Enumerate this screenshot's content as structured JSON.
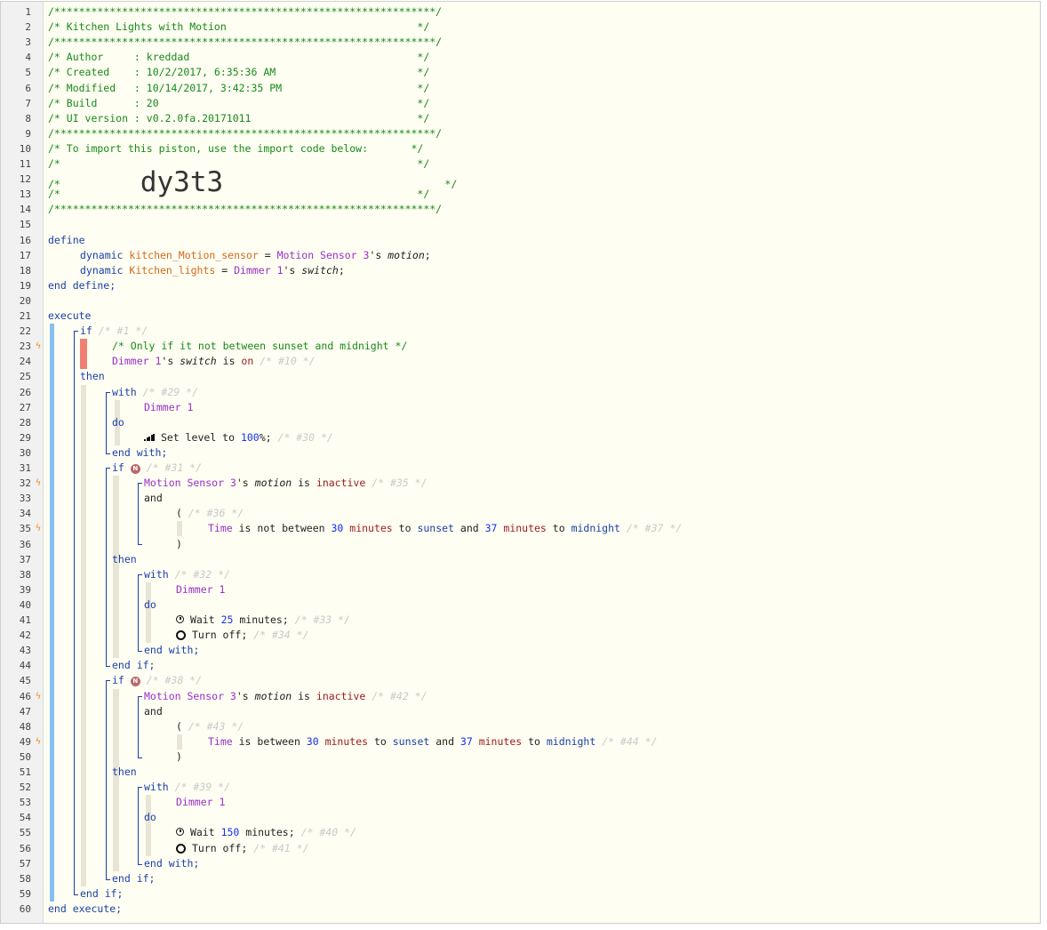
{
  "editor": {
    "lines": [
      {
        "n": 1,
        "indent": 0,
        "segs": [
          [
            "c-comment",
            "/**************************************************************/"
          ]
        ]
      },
      {
        "n": 2,
        "indent": 0,
        "segs": [
          [
            "c-comment",
            "/* Kitchen Lights with Motion                               */"
          ]
        ]
      },
      {
        "n": 3,
        "indent": 0,
        "segs": [
          [
            "c-comment",
            "/**************************************************************/"
          ]
        ]
      },
      {
        "n": 4,
        "indent": 0,
        "segs": [
          [
            "c-comment",
            "/* Author     : kreddad                                     */"
          ]
        ]
      },
      {
        "n": 5,
        "indent": 0,
        "segs": [
          [
            "c-comment",
            "/* Created    : 10/2/2017, 6:35:36 AM                       */"
          ]
        ]
      },
      {
        "n": 6,
        "indent": 0,
        "segs": [
          [
            "c-comment",
            "/* Modified   : 10/14/2017, 3:42:35 PM                      */"
          ]
        ]
      },
      {
        "n": 7,
        "indent": 0,
        "segs": [
          [
            "c-comment",
            "/* Build      : 20                                          */"
          ]
        ]
      },
      {
        "n": 8,
        "indent": 0,
        "segs": [
          [
            "c-comment",
            "/* UI version : v0.2.0fa.20171011                           */"
          ]
        ]
      },
      {
        "n": 9,
        "indent": 0,
        "segs": [
          [
            "c-comment",
            "/**************************************************************/"
          ]
        ]
      },
      {
        "n": 10,
        "indent": 0,
        "segs": [
          [
            "c-comment",
            "/* To import this piston, use the import code below:       */"
          ]
        ]
      },
      {
        "n": 11,
        "indent": 0,
        "segs": [
          [
            "c-comment",
            "/*                                                          */"
          ]
        ]
      },
      {
        "n": 12,
        "indent": 0,
        "segs": [
          [
            "c-comment",
            "/*             "
          ],
          [
            "c-big",
            "dy3t3"
          ],
          [
            "c-comment",
            "                                    */"
          ]
        ]
      },
      {
        "n": 13,
        "indent": 0,
        "segs": [
          [
            "c-comment",
            "/*                                                          */"
          ]
        ]
      },
      {
        "n": 14,
        "indent": 0,
        "segs": [
          [
            "c-comment",
            "/**************************************************************/"
          ]
        ]
      },
      {
        "n": 15,
        "indent": 0,
        "segs": []
      },
      {
        "n": 16,
        "indent": 0,
        "segs": [
          [
            "c-kw",
            "define"
          ]
        ]
      },
      {
        "n": 17,
        "indent": 1,
        "segs": [
          [
            "c-kw",
            "dynamic "
          ],
          [
            "c-var",
            "kitchen_Motion_sensor"
          ],
          [
            "c-text",
            " = "
          ],
          [
            "c-ref",
            "Motion Sensor 3"
          ],
          [
            "c-text",
            "'s "
          ],
          [
            "c-prop",
            "motion"
          ],
          [
            "c-text",
            ";"
          ]
        ]
      },
      {
        "n": 18,
        "indent": 1,
        "segs": [
          [
            "c-kw",
            "dynamic "
          ],
          [
            "c-var",
            "Kitchen_lights"
          ],
          [
            "c-text",
            " = "
          ],
          [
            "c-ref",
            "Dimmer 1"
          ],
          [
            "c-text",
            "'s "
          ],
          [
            "c-prop",
            "switch"
          ],
          [
            "c-text",
            ";"
          ]
        ]
      },
      {
        "n": 19,
        "indent": 0,
        "segs": [
          [
            "c-kw",
            "end define;"
          ]
        ]
      },
      {
        "n": 20,
        "indent": 0,
        "segs": []
      },
      {
        "n": 21,
        "indent": 0,
        "segs": [
          [
            "c-kw",
            "execute"
          ]
        ]
      },
      {
        "n": 22,
        "indent": 1,
        "segs": [
          [
            "c-kw",
            "if "
          ],
          [
            "c-faint",
            "/* #1 */"
          ]
        ]
      },
      {
        "n": 23,
        "indent": 2,
        "bolt": true,
        "segs": [
          [
            "c-comment",
            "/* Only if it not between sunset and midnight */"
          ]
        ]
      },
      {
        "n": 24,
        "indent": 2,
        "segs": [
          [
            "c-ref",
            "Dimmer 1"
          ],
          [
            "c-text",
            "'s "
          ],
          [
            "c-prop",
            "switch"
          ],
          [
            "c-text",
            " is "
          ],
          [
            "c-val",
            "on"
          ],
          [
            "c-faint",
            " /* #10 */"
          ]
        ]
      },
      {
        "n": 25,
        "indent": 1,
        "segs": [
          [
            "c-kw",
            "then"
          ]
        ]
      },
      {
        "n": 26,
        "indent": 2,
        "segs": [
          [
            "c-kw",
            "with "
          ],
          [
            "c-faint",
            "/* #29 */"
          ]
        ]
      },
      {
        "n": 27,
        "indent": 3,
        "segs": [
          [
            "c-ref",
            "Dimmer 1"
          ]
        ]
      },
      {
        "n": 28,
        "indent": 2,
        "segs": [
          [
            "c-kw",
            "do"
          ]
        ]
      },
      {
        "n": 29,
        "indent": 3,
        "icon": "bars",
        "segs": [
          [
            "c-text",
            "Set level to "
          ],
          [
            "c-num",
            "100"
          ],
          [
            "c-text",
            "%; "
          ],
          [
            "c-faint",
            "/* #30 */"
          ]
        ]
      },
      {
        "n": 30,
        "indent": 2,
        "segs": [
          [
            "c-kw",
            "end with;"
          ]
        ]
      },
      {
        "n": 31,
        "indent": 2,
        "badge": "N",
        "segs": [
          [
            "c-kw",
            "if "
          ],
          [
            "c-faint",
            "/* #31 */"
          ]
        ]
      },
      {
        "n": 32,
        "indent": 3,
        "bolt": true,
        "segs": [
          [
            "c-ref",
            "Motion Sensor 3"
          ],
          [
            "c-text",
            "'s "
          ],
          [
            "c-prop",
            "motion"
          ],
          [
            "c-text",
            " is "
          ],
          [
            "c-val",
            "inactive"
          ],
          [
            "c-faint",
            " /* #35 */"
          ]
        ]
      },
      {
        "n": 33,
        "indent": 3,
        "segs": [
          [
            "c-text",
            "and"
          ]
        ]
      },
      {
        "n": 34,
        "indent": 4,
        "segs": [
          [
            "c-text",
            "( "
          ],
          [
            "c-faint",
            "/* #36 */"
          ]
        ]
      },
      {
        "n": 35,
        "indent": 5,
        "bolt": true,
        "segs": [
          [
            "c-ref",
            "Time"
          ],
          [
            "c-text",
            " is not between "
          ],
          [
            "c-num",
            "30"
          ],
          [
            "c-val",
            " minutes"
          ],
          [
            "c-text",
            " to "
          ],
          [
            "c-kw",
            "sunset"
          ],
          [
            "c-text",
            " and "
          ],
          [
            "c-num",
            "37"
          ],
          [
            "c-val",
            " minutes"
          ],
          [
            "c-text",
            " to "
          ],
          [
            "c-kw",
            "midnight"
          ],
          [
            "c-faint",
            " /* #37 */"
          ]
        ]
      },
      {
        "n": 36,
        "indent": 4,
        "segs": [
          [
            "c-text",
            ")"
          ]
        ]
      },
      {
        "n": 37,
        "indent": 2,
        "segs": [
          [
            "c-kw",
            "then"
          ]
        ]
      },
      {
        "n": 38,
        "indent": 3,
        "segs": [
          [
            "c-kw",
            "with "
          ],
          [
            "c-faint",
            "/* #32 */"
          ]
        ]
      },
      {
        "n": 39,
        "indent": 4,
        "segs": [
          [
            "c-ref",
            "Dimmer 1"
          ]
        ]
      },
      {
        "n": 40,
        "indent": 3,
        "segs": [
          [
            "c-kw",
            "do"
          ]
        ]
      },
      {
        "n": 41,
        "indent": 4,
        "icon": "clock",
        "segs": [
          [
            "c-text",
            "Wait "
          ],
          [
            "c-num",
            "25"
          ],
          [
            "c-text",
            " minutes; "
          ],
          [
            "c-faint",
            "/* #33 */"
          ]
        ]
      },
      {
        "n": 42,
        "indent": 4,
        "icon": "ring",
        "segs": [
          [
            "c-text",
            "Turn off; "
          ],
          [
            "c-faint",
            "/* #34 */"
          ]
        ]
      },
      {
        "n": 43,
        "indent": 3,
        "segs": [
          [
            "c-kw",
            "end with;"
          ]
        ]
      },
      {
        "n": 44,
        "indent": 2,
        "segs": [
          [
            "c-kw",
            "end if;"
          ]
        ]
      },
      {
        "n": 45,
        "indent": 2,
        "badge": "N",
        "segs": [
          [
            "c-kw",
            "if "
          ],
          [
            "c-faint",
            "/* #38 */"
          ]
        ]
      },
      {
        "n": 46,
        "indent": 3,
        "bolt": true,
        "segs": [
          [
            "c-ref",
            "Motion Sensor 3"
          ],
          [
            "c-text",
            "'s "
          ],
          [
            "c-prop",
            "motion"
          ],
          [
            "c-text",
            " is "
          ],
          [
            "c-val",
            "inactive"
          ],
          [
            "c-faint",
            " /* #42 */"
          ]
        ]
      },
      {
        "n": 47,
        "indent": 3,
        "segs": [
          [
            "c-text",
            "and"
          ]
        ]
      },
      {
        "n": 48,
        "indent": 4,
        "segs": [
          [
            "c-text",
            "( "
          ],
          [
            "c-faint",
            "/* #43 */"
          ]
        ]
      },
      {
        "n": 49,
        "indent": 5,
        "bolt": true,
        "segs": [
          [
            "c-ref",
            "Time"
          ],
          [
            "c-text",
            " is between "
          ],
          [
            "c-num",
            "30"
          ],
          [
            "c-val",
            " minutes"
          ],
          [
            "c-text",
            " to "
          ],
          [
            "c-kw",
            "sunset"
          ],
          [
            "c-text",
            " and "
          ],
          [
            "c-num",
            "37"
          ],
          [
            "c-val",
            " minutes"
          ],
          [
            "c-text",
            " to "
          ],
          [
            "c-kw",
            "midnight"
          ],
          [
            "c-faint",
            " /* #44 */"
          ]
        ]
      },
      {
        "n": 50,
        "indent": 4,
        "segs": [
          [
            "c-text",
            ")"
          ]
        ]
      },
      {
        "n": 51,
        "indent": 2,
        "segs": [
          [
            "c-kw",
            "then"
          ]
        ]
      },
      {
        "n": 52,
        "indent": 3,
        "segs": [
          [
            "c-kw",
            "with "
          ],
          [
            "c-faint",
            "/* #39 */"
          ]
        ]
      },
      {
        "n": 53,
        "indent": 4,
        "segs": [
          [
            "c-ref",
            "Dimmer 1"
          ]
        ]
      },
      {
        "n": 54,
        "indent": 3,
        "segs": [
          [
            "c-kw",
            "do"
          ]
        ]
      },
      {
        "n": 55,
        "indent": 4,
        "icon": "clock",
        "segs": [
          [
            "c-text",
            "Wait "
          ],
          [
            "c-num",
            "150"
          ],
          [
            "c-text",
            " minutes; "
          ],
          [
            "c-faint",
            "/* #40 */"
          ]
        ]
      },
      {
        "n": 56,
        "indent": 4,
        "icon": "ring",
        "segs": [
          [
            "c-text",
            "Turn off; "
          ],
          [
            "c-faint",
            "/* #41 */"
          ]
        ]
      },
      {
        "n": 57,
        "indent": 3,
        "segs": [
          [
            "c-kw",
            "end with;"
          ]
        ]
      },
      {
        "n": 58,
        "indent": 2,
        "segs": [
          [
            "c-kw",
            "end if;"
          ]
        ]
      },
      {
        "n": 59,
        "indent": 1,
        "segs": [
          [
            "c-kw",
            "end if;"
          ]
        ]
      },
      {
        "n": 60,
        "indent": 0,
        "segs": [
          [
            "c-kw",
            "end execute;"
          ]
        ]
      }
    ]
  }
}
